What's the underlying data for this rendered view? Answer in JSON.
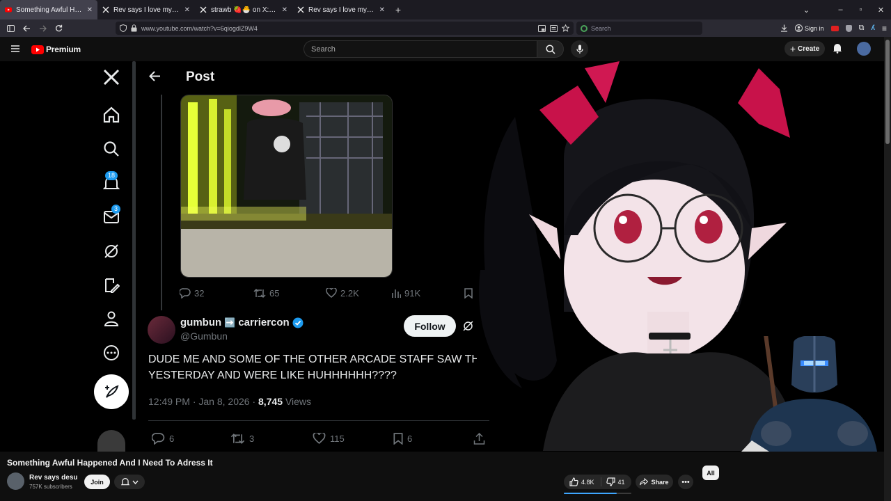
{
  "browser": {
    "tabs": [
      {
        "title": "Something Awful Happened And I Need To Adress It",
        "favicon": "youtube-icon",
        "active": true
      },
      {
        "title": "Rev says I love my wife (@Rev_s",
        "favicon": "x-icon",
        "active": false
      },
      {
        "title": "strawb 🍓🐣 on X: \"now THIS i",
        "favicon": "x-icon",
        "active": false
      },
      {
        "title": "Rev says I love my wife on X: \"-",
        "favicon": "x-icon",
        "active": false
      }
    ],
    "close_glyph": "✕",
    "url": "www.youtube.com/watch?v=6qiogdlZ9W4",
    "search_placeholder": "Search",
    "sign_in": "Sign in"
  },
  "youtube": {
    "logo_text": "Premium",
    "search_placeholder": "Search",
    "create_label": "Create"
  },
  "x_post": {
    "header_title": "Post",
    "badges": {
      "notifications": "18",
      "messages": "3"
    },
    "quoted_stats": {
      "replies": "32",
      "reposts": "65",
      "likes": "2.2K",
      "views": "91K"
    },
    "author": {
      "name_a": "gumbun",
      "name_emoji": "➡️",
      "name_b": "carriercon",
      "handle": "@Gumbun",
      "verified": true
    },
    "follow_label": "Follow",
    "text_line1": "DUDE ME AND SOME OF THE OTHER ARCADE STAFF SAW THIS",
    "text_line2": "YESTERDAY AND WERE LIKE HUHHHHHH????",
    "time": "12:49 PM",
    "date": "Jan 8, 2026",
    "dot": "·",
    "views_count": "8,745",
    "views_label": "Views",
    "stats": {
      "replies": "6",
      "reposts": "3",
      "likes": "115",
      "bookmarks": "6"
    }
  },
  "video": {
    "title": "Something Awful Happened And I Need To Adress It",
    "channel": "Rev says desu",
    "subscribers": "757K subscribers",
    "join_label": "Join",
    "likes": "4.8K",
    "dislikes": "41",
    "like_ratio": 0.78,
    "share_label": "Share",
    "chip_all": "All"
  },
  "colors": {
    "accent_x": "#1d9bf0",
    "yt_red": "#ff0000",
    "like_bar": "#3ea6ff"
  }
}
